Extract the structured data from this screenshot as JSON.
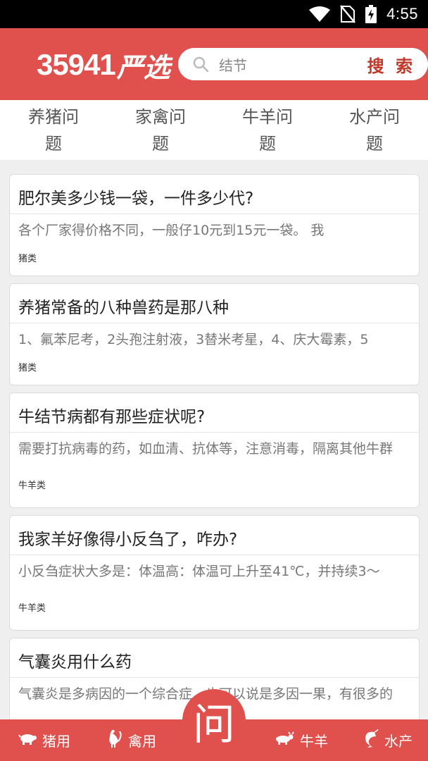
{
  "status_bar": {
    "time": "4:55"
  },
  "header": {
    "logo_number": "35941",
    "logo_text": "严选",
    "search_value": "结节",
    "search_button": "搜 索"
  },
  "tabs": [
    {
      "label": "养猪问题"
    },
    {
      "label": "家禽问题"
    },
    {
      "label": "牛羊问题"
    },
    {
      "label": "水产问题"
    }
  ],
  "questions": [
    {
      "title": "肥尔美多少钱一袋，一件多少代?",
      "answer": "各个厂家得价格不同，一般仔10元到15元一袋。 我",
      "tag": "猪类"
    },
    {
      "title": "养猪常备的八种兽药是那八种",
      "answer": "1、氟苯尼考，2头孢注射液，3替米考星，4、庆大霉素，5",
      "tag": "猪类"
    },
    {
      "title": "牛结节病都有那些症状呢?",
      "answer": "需要打抗病毒的药，如血清、抗体等，注意消毒，隔离其他牛群",
      "tag": "牛羊类"
    },
    {
      "title": "我家羊好像得小反刍了，咋办?",
      "answer": "小反刍症状大多是：体温高：体温可上升至41℃，并持续3～",
      "tag": "牛羊类"
    },
    {
      "title": "气囊炎用什么药",
      "answer": "气囊炎是多病因的一个综合症，也可以说是多因一果，有很多的",
      "tag": ""
    }
  ],
  "bottom_nav": {
    "pig": "猪用",
    "poultry": "禽用",
    "ask": "问",
    "cattle": "牛羊",
    "aquatic": "水产"
  },
  "colors": {
    "brand": "#e0504c",
    "search_button": "#c0392b"
  }
}
